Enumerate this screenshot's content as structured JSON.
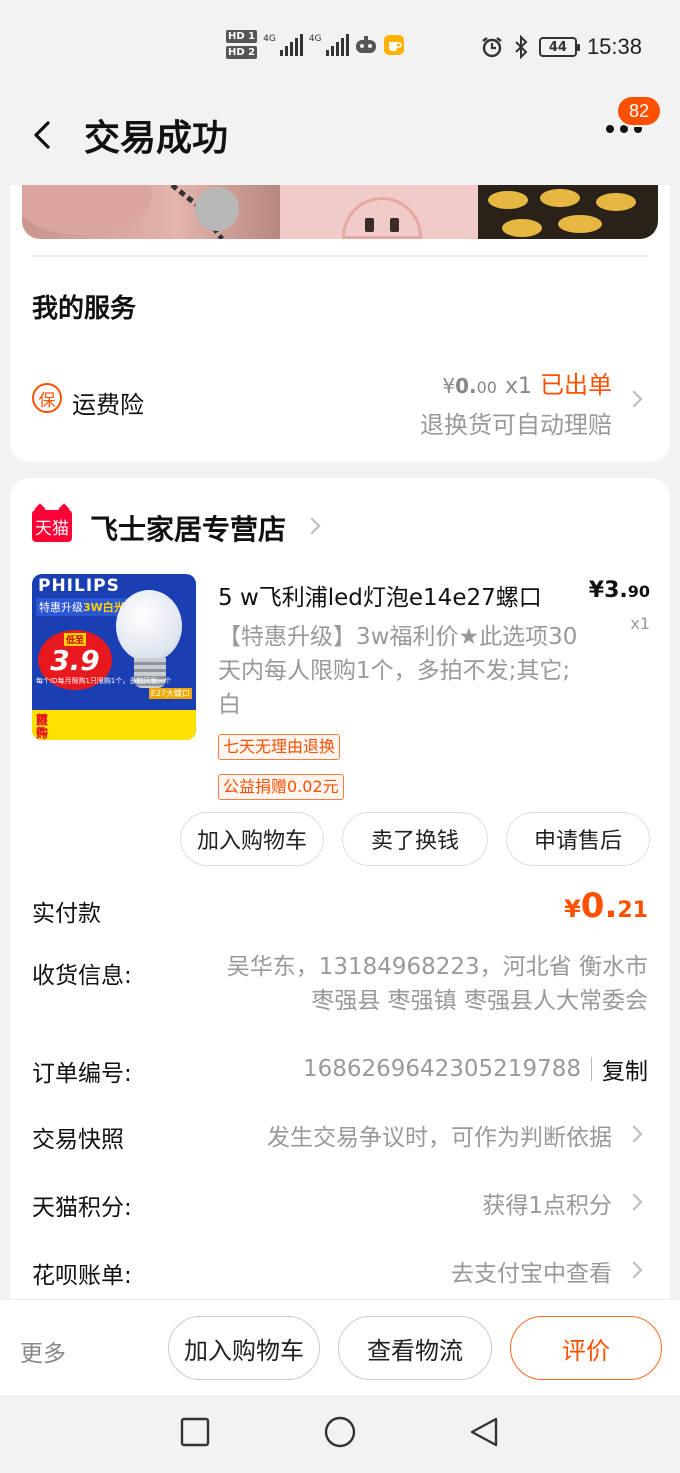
{
  "status_bar": {
    "hd1": "HD 1",
    "hd2": "HD 2",
    "net1": "4G",
    "net2": "4G",
    "battery": "44",
    "time": "15:38"
  },
  "nav": {
    "title": "交易成功",
    "badge": "82"
  },
  "service": {
    "section_title": "我的服务",
    "icon_char": "保",
    "name": "运费险",
    "price_prefix": "¥",
    "price_int": "0.",
    "price_dec": "00",
    "qty": "x1",
    "status": "已出单",
    "desc": "退换货可自动理赔"
  },
  "store": {
    "logo_text": "天猫",
    "name": "飞士家居专营店"
  },
  "product": {
    "image": {
      "brand": "PHILIPS",
      "sub_prefix": "特惠升级",
      "sub_highlight": "3W白光",
      "burst_top": "低至",
      "burst_price": "3.9",
      "tag": "E27大螺口",
      "line": "每个ID每月限购1只限购1个，多拍只发一个",
      "bottom_line1": "首件特惠",
      "bottom_line2": "限购1只"
    },
    "title": "5 w飞利浦led灯泡e14e27螺口",
    "sku": "【特惠升级】3w福利价★此选项30天内每人限购1个，多拍不发;其它;白",
    "price_prefix": "¥",
    "price_int": "3.",
    "price_dec": "90",
    "qty": "x1",
    "tags": [
      "七天无理由退换",
      "公益捐赠0.02元"
    ],
    "actions": [
      "加入购物车",
      "卖了换钱",
      "申请售后"
    ]
  },
  "order_info": {
    "paid_label": "实付款",
    "paid_prefix": "¥",
    "paid_int": "0.",
    "paid_dec": "21",
    "address_label": "收货信息:",
    "address": "吴华东，13184968223，河北省 衡水市 枣强县 枣强镇 枣强县人大常委会",
    "order_no_label": "订单编号:",
    "order_no": "1686269642305219788",
    "copy": "复制",
    "snapshot_label": "交易快照",
    "snapshot_value": "发生交易争议时，可作为判断依据",
    "points_label": "天猫积分:",
    "points_value": "获得1点积分",
    "huabei_label": "花呗账单:",
    "huabei_value": "去支付宝中查看"
  },
  "bottom_bar": {
    "more": "更多",
    "buttons": [
      "加入购物车",
      "查看物流",
      "评价"
    ]
  },
  "colors": {
    "accent": "#ff5000",
    "tmall_red": "#ff0036",
    "muted": "#999999"
  }
}
